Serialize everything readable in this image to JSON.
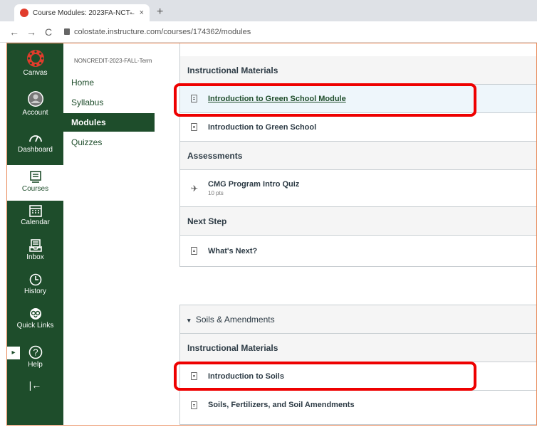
{
  "browser": {
    "tab_title": "Course Modules: 2023FA-NCT-̶",
    "tab_close": "×",
    "new_tab": "+",
    "url": "colostate.instructure.com/courses/174362/modules",
    "nav": {
      "back": "←",
      "forward": "→",
      "reload": "C"
    }
  },
  "global_nav": {
    "items": [
      {
        "label": "Canvas",
        "icon": "canvas-logo-icon"
      },
      {
        "label": "Account",
        "icon": "account-icon"
      },
      {
        "label": "Dashboard",
        "icon": "dashboard-icon"
      },
      {
        "label": "Courses",
        "icon": "courses-icon",
        "active": true
      },
      {
        "label": "Calendar",
        "icon": "calendar-icon"
      },
      {
        "label": "Inbox",
        "icon": "inbox-icon"
      },
      {
        "label": "History",
        "icon": "history-icon"
      },
      {
        "label": "Quick Links",
        "icon": "ram-icon"
      },
      {
        "label": "Help",
        "icon": "help-icon"
      }
    ],
    "collapse": "|←"
  },
  "course_nav": {
    "course_code": "NONCREDIT-2023-FALL-Term",
    "links": [
      {
        "label": "Home"
      },
      {
        "label": "Syllabus"
      },
      {
        "label": "Modules",
        "active": true
      },
      {
        "label": "Quizzes"
      }
    ]
  },
  "modules": {
    "module1": {
      "sections": [
        {
          "title": "Instructional Materials"
        },
        {
          "title": "Assessments"
        },
        {
          "title": "Next Step"
        }
      ],
      "items": [
        {
          "title": "Introduction to Green School Module",
          "type": "page",
          "highlighted": true
        },
        {
          "title": "Introduction to Green School",
          "type": "page"
        },
        {
          "title": "CMG Program Intro Quiz",
          "type": "quiz",
          "meta": "10 pts"
        },
        {
          "title": "What's Next?",
          "type": "assignment"
        }
      ]
    },
    "module2": {
      "title": "Soils & Amendments",
      "collapse_icon": "▾",
      "sections": [
        {
          "title": "Instructional Materials"
        }
      ],
      "items": [
        {
          "title": "Introduction to Soils",
          "type": "page",
          "highlighted": true
        },
        {
          "title": "Soils, Fertilizers, and Soil Amendments",
          "type": "page"
        }
      ]
    }
  },
  "colors": {
    "brand_green": "#1e4d2b",
    "highlight_red": "#e00000"
  }
}
